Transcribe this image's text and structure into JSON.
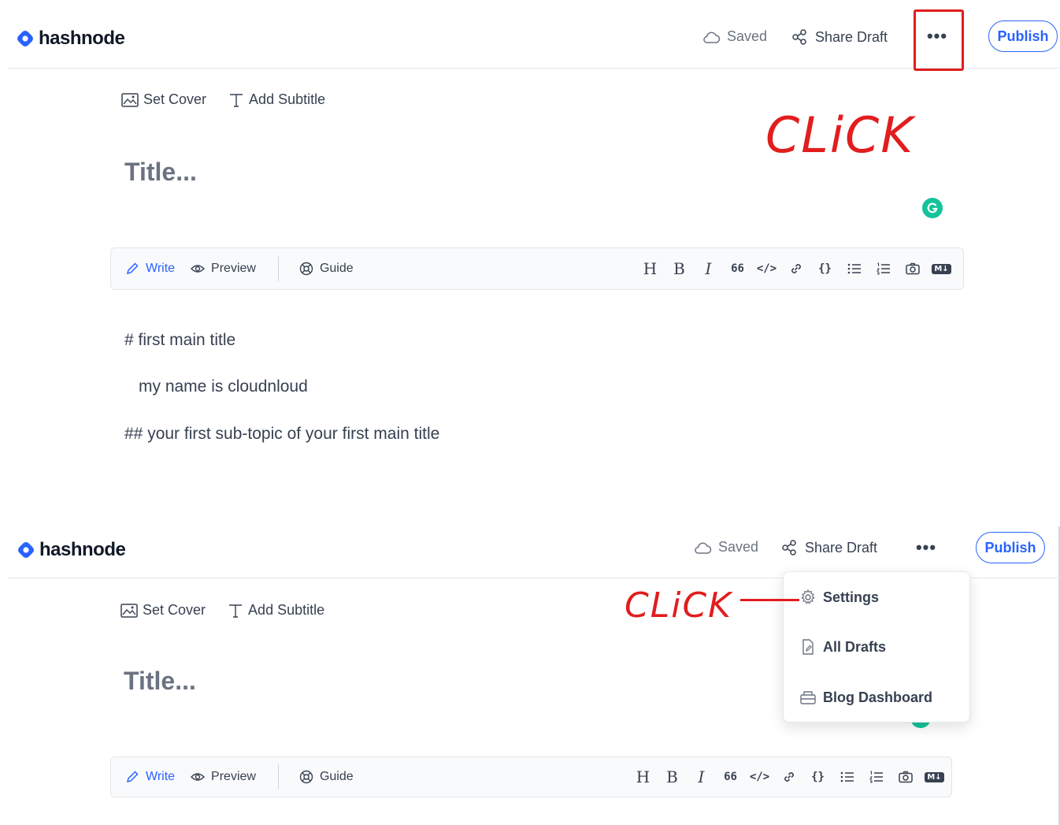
{
  "brand": {
    "name": "hashnode",
    "accent": "#2962ff"
  },
  "top_screen": {
    "header": {
      "saved_label": "Saved",
      "share_label": "Share Draft",
      "more_label": "•••",
      "publish_label": "Publish"
    },
    "cover": {
      "set_cover": "Set Cover",
      "add_subtitle": "Add Subtitle"
    },
    "title_placeholder": "Title...",
    "toolbar": {
      "write": "Write",
      "preview": "Preview",
      "guide": "Guide"
    },
    "content": [
      "# first main title",
      "my name is cloudnloud",
      "## your first sub-topic of your first main title"
    ],
    "annotation": "CLiCK"
  },
  "bottom_screen": {
    "header": {
      "saved_label": "Saved",
      "share_label": "Share Draft",
      "more_label": "•••",
      "publish_label": "Publish"
    },
    "cover": {
      "set_cover": "Set Cover",
      "add_subtitle": "Add Subtitle"
    },
    "title_placeholder": "Title...",
    "toolbar": {
      "write": "Write",
      "preview": "Preview",
      "guide": "Guide"
    },
    "menu": {
      "settings": "Settings",
      "all_drafts": "All Drafts",
      "blog_dashboard": "Blog Dashboard"
    },
    "annotation": "CLiCK"
  },
  "format_buttons": {
    "heading": "H",
    "bold": "B",
    "italic": "I",
    "quote": "66",
    "code": "</>",
    "link": "link-icon",
    "codeblock": "{}",
    "bullet_list": "bullet-list-icon",
    "numbered_list": "numbered-list-icon",
    "image": "camera-icon",
    "markdown": "M↓"
  },
  "colors": {
    "annotation_red": "#e11d1d",
    "grammarly_green": "#15c39a"
  }
}
